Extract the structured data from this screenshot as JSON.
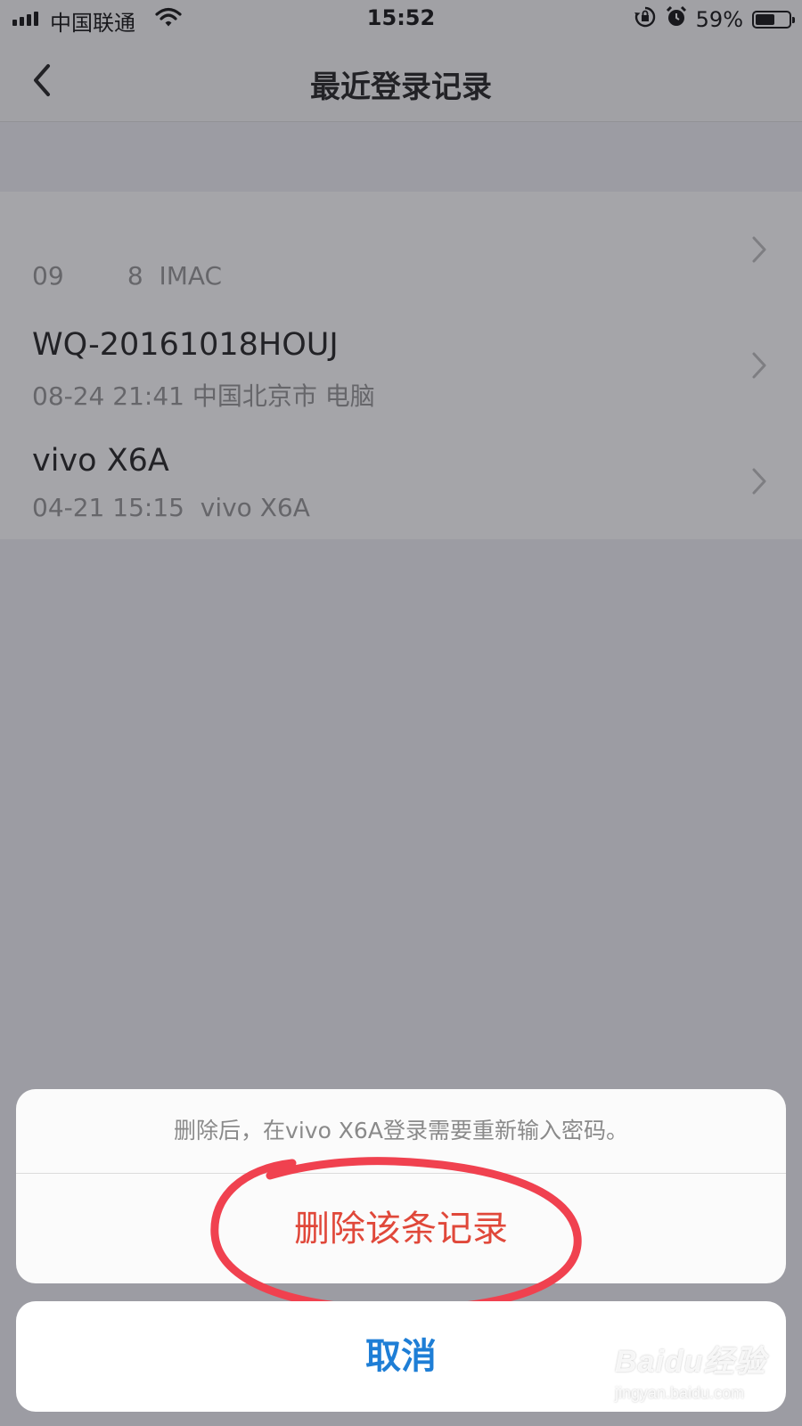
{
  "status_bar": {
    "carrier": "中国联通",
    "time": "15:52",
    "battery_percent": "59%",
    "battery_level": 0.59,
    "icons": [
      "signal-icon",
      "wifi-icon",
      "rotation-lock-icon",
      "alarm-icon",
      "battery-icon"
    ]
  },
  "nav": {
    "title": "最近登录记录",
    "back_icon": "chevron-left-icon"
  },
  "records": [
    {
      "name": "",
      "detail": "09        8  IMAC",
      "blurred": true
    },
    {
      "name": "WQ-20161018HOUJ",
      "detail": "08-24 21:41 中国北京市 电脑"
    },
    {
      "name": "vivo X6A",
      "detail": "04-21 15:15  vivo X6A"
    }
  ],
  "action_sheet": {
    "message": "删除后，在vivo X6A登录需要重新输入密码。",
    "delete_label": "删除该条记录",
    "cancel_label": "取消",
    "delete_color": "#e0483a",
    "cancel_color": "#1e7ed6",
    "annotation_color": "#f0414f"
  },
  "watermark": {
    "logo_text": "Baidu经验",
    "url": "jingyan.baidu.com"
  }
}
